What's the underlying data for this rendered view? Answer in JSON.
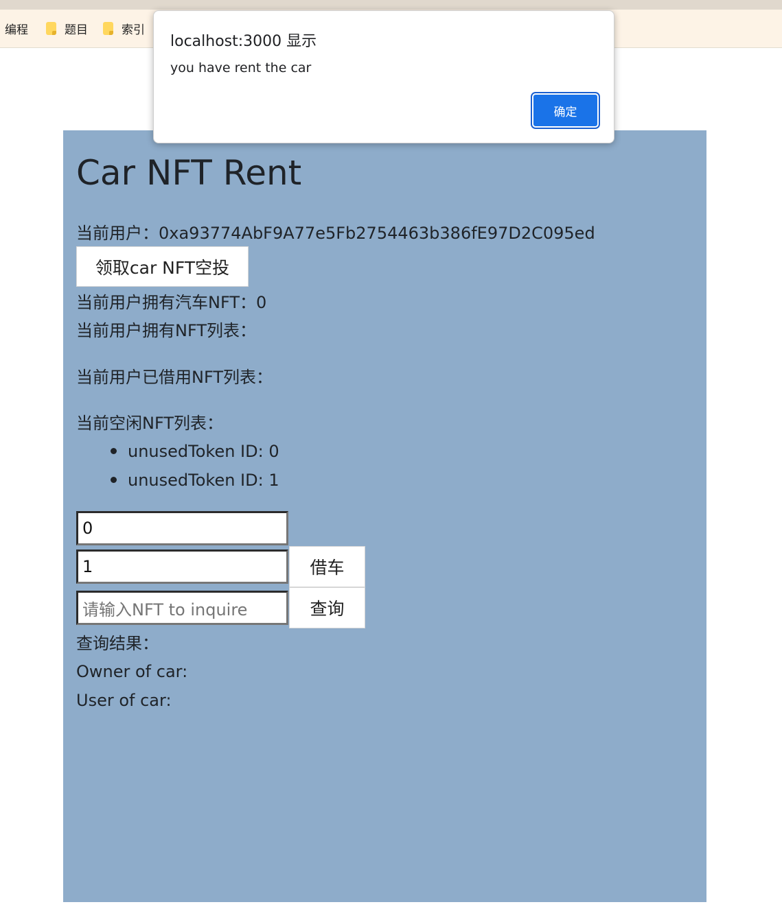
{
  "bookmarks": [
    {
      "label": "编程",
      "icon": "none"
    },
    {
      "label": "题目",
      "icon": "folder-icon"
    },
    {
      "label": "索引",
      "icon": "folder-icon"
    }
  ],
  "app": {
    "title": "Car NFT Rent",
    "current_user_label": "当前用户：",
    "current_user_address": "0xa93774AbF9A77e5Fb2754463b386fE97D2C095ed",
    "airdrop_button": "领取car NFT空投",
    "owned_count_label": "当前用户拥有汽车NFT：",
    "owned_count": "0",
    "owned_list_label": "当前用户拥有NFT列表：",
    "borrowed_list_label": "当前用户已借用NFT列表：",
    "unused_list_label": "当前空闲NFT列表：",
    "unused_tokens": [
      "unusedToken ID: 0",
      "unusedToken ID: 1"
    ],
    "input_token_value": "0",
    "input_duration_value": "1",
    "rent_button": "借车",
    "inquire_placeholder": "请输入NFT to inquire",
    "query_button": "查询",
    "query_result_label": "查询结果：",
    "owner_label": "Owner of car:",
    "user_label": "User of car:"
  },
  "dialog": {
    "title": "localhost:3000 显示",
    "message": "you have rent the car",
    "ok_button": "确定"
  },
  "colors": {
    "panel_bg": "#8eacca",
    "dialog_ok_bg": "#1a73e8",
    "bookmark_bar_bg": "#fdf3e6"
  }
}
